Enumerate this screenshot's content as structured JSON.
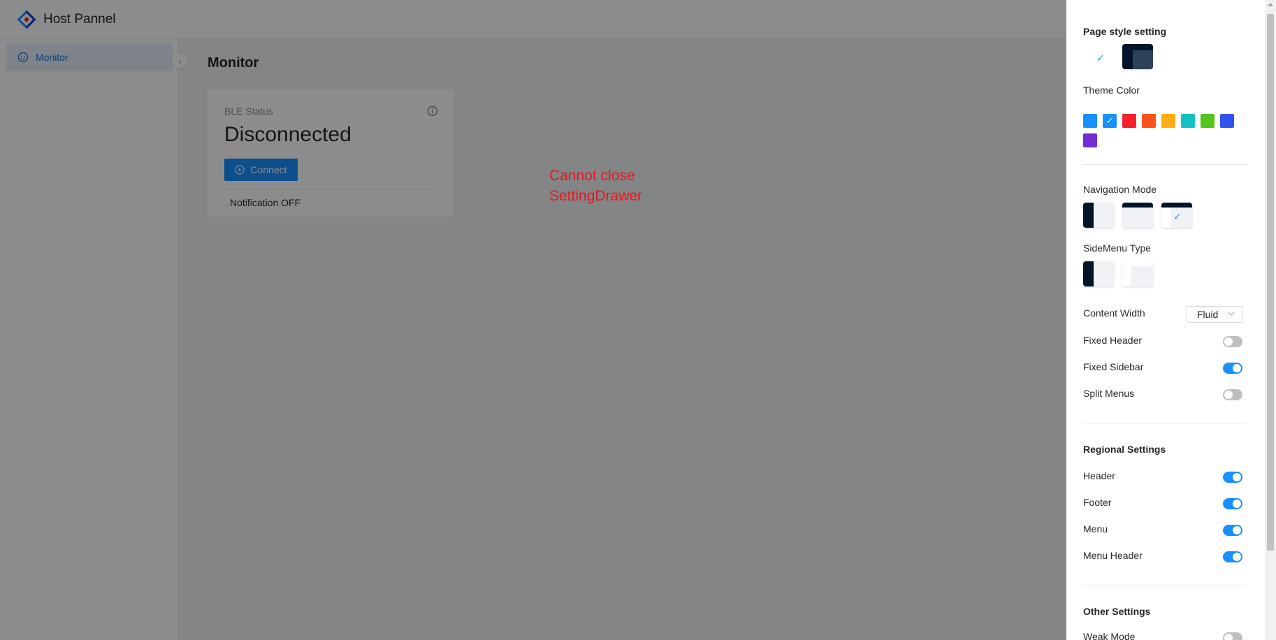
{
  "header": {
    "title": "Host Pannel",
    "logo_icon": "diamond-logo-icon"
  },
  "sidebar": {
    "items": [
      {
        "label": "Monitor",
        "icon": "smile-icon"
      }
    ],
    "collapse_glyph": "‹"
  },
  "main": {
    "title": "Monitor",
    "card": {
      "label": "BLE Status",
      "value": "Disconnected",
      "button": "Connect",
      "footer": "Notification OFF"
    },
    "annotation": {
      "line1": "Cannot close",
      "line2": "SettingDrawer"
    }
  },
  "drawer": {
    "page_style": {
      "title": "Page style setting",
      "selected": "light"
    },
    "theme_color": {
      "title": "Theme Color",
      "colors": [
        "#1890ff",
        "#1890ff",
        "#f5222d",
        "#fa541c",
        "#faad14",
        "#13c2c2",
        "#52c41a",
        "#2f54eb",
        "#722ed1"
      ],
      "selected_index": 1,
      "check_glyph": "✓"
    },
    "navigation_mode": {
      "title": "Navigation Mode",
      "selected": "mix"
    },
    "sidemenu_type": {
      "title": "SideMenu Type"
    },
    "content_width": {
      "label": "Content Width",
      "value": "Fluid"
    },
    "toggles": [
      {
        "label": "Fixed Header",
        "on": false
      },
      {
        "label": "Fixed Sidebar",
        "on": true
      },
      {
        "label": "Split Menus",
        "on": false
      }
    ],
    "regional": {
      "title": "Regional Settings",
      "toggles": [
        {
          "label": "Header",
          "on": true
        },
        {
          "label": "Footer",
          "on": true
        },
        {
          "label": "Menu",
          "on": true
        },
        {
          "label": "Menu Header",
          "on": true
        }
      ]
    },
    "other": {
      "title": "Other Settings",
      "toggles": [
        {
          "label": "Weak Mode",
          "on": false
        }
      ]
    }
  }
}
